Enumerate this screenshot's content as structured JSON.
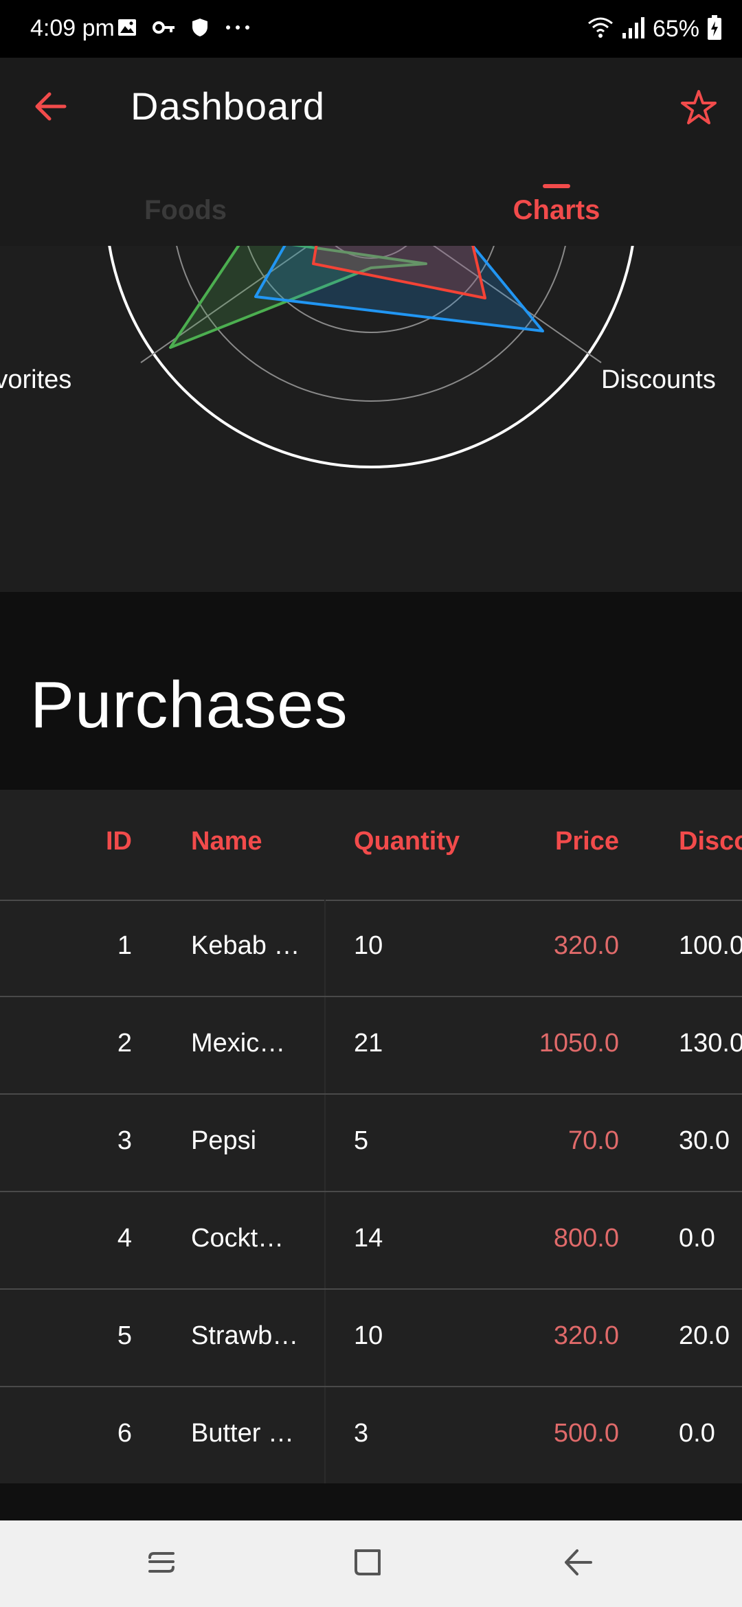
{
  "status_bar": {
    "time": "4:09 pm",
    "battery": "65%",
    "icons_left": [
      "image-icon",
      "key-icon",
      "shield-icon",
      "more-dots-icon"
    ],
    "icons_right": [
      "wifi-icon",
      "signal-icon",
      "battery-icon"
    ]
  },
  "app_bar": {
    "title": "Dashboard",
    "back_icon": "arrow-left-icon",
    "action_icon": "star-icon",
    "accent_color": "#f24b4b",
    "tabs": [
      {
        "label": "Foods",
        "selected": false
      },
      {
        "label": "Charts",
        "selected": true
      }
    ]
  },
  "chart_data": {
    "type": "radar",
    "axis_labels": [
      "Favorites",
      "Discounts"
    ],
    "series_colors": [
      "#4caf50",
      "#2196f3",
      "#f44336"
    ]
  },
  "purchases": {
    "title": "Purchases",
    "columns": [
      "ID",
      "Name",
      "Quantity",
      "Price",
      "Disco"
    ],
    "rows": [
      {
        "id": "1",
        "name": "Kebab …",
        "quantity": "10",
        "price": "320.0",
        "discount": "100.0"
      },
      {
        "id": "2",
        "name": "Mexic…",
        "quantity": "21",
        "price": "1050.0",
        "discount": "130.0"
      },
      {
        "id": "3",
        "name": "Pepsi",
        "quantity": "5",
        "price": "70.0",
        "discount": "30.0"
      },
      {
        "id": "4",
        "name": "Cockt…",
        "quantity": "14",
        "price": "800.0",
        "discount": "0.0"
      },
      {
        "id": "5",
        "name": "Strawb…",
        "quantity": "10",
        "price": "320.0",
        "discount": "20.0"
      },
      {
        "id": "6",
        "name": "Butter …",
        "quantity": "3",
        "price": "500.0",
        "discount": "0.0"
      }
    ]
  },
  "nav_bar": {
    "buttons": [
      "recent-apps-icon",
      "home-icon",
      "back-icon"
    ]
  }
}
